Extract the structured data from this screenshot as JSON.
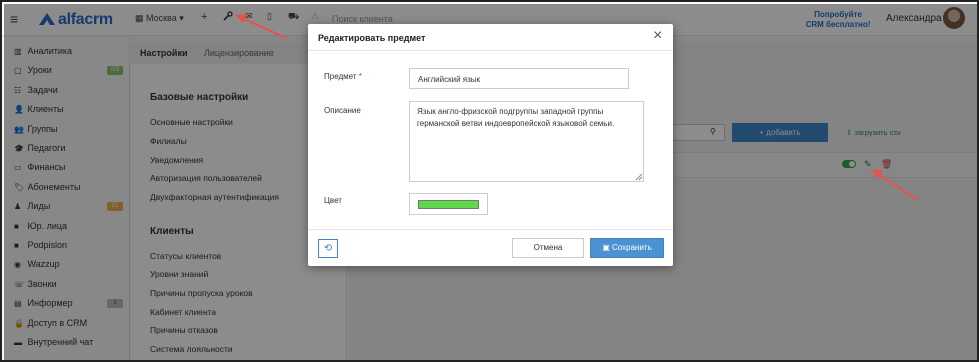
{
  "topbar": {
    "logo_text": "alfacrm",
    "city": "Москва ▾",
    "search_placeholder": "Поиск клиента",
    "try_line1": "Попробуйте",
    "try_line2": "CRM бесплатно!",
    "user_name": "Александра",
    "icons": [
      "menu-icon",
      "building-icon",
      "plus-icon",
      "wrench-icon",
      "envelope-icon",
      "phone-icon",
      "cart-icon",
      "bell-icon"
    ]
  },
  "sidebar": {
    "items": [
      {
        "label": "Аналитика",
        "icon": "chart-icon"
      },
      {
        "label": "Уроки",
        "icon": "calendar-icon",
        "badge": "0/3"
      },
      {
        "label": "Задачи",
        "icon": "tasks-icon"
      },
      {
        "label": "Клиенты",
        "icon": "user-icon"
      },
      {
        "label": "Группы",
        "icon": "users-icon"
      },
      {
        "label": "Педагоги",
        "icon": "graduation-icon"
      },
      {
        "label": "Финансы",
        "icon": "money-icon"
      },
      {
        "label": "Абонементы",
        "icon": "tag-icon"
      },
      {
        "label": "Лиды",
        "icon": "lead-icon",
        "badge": "21"
      },
      {
        "label": "Юр. лица",
        "icon": "briefcase-icon"
      },
      {
        "label": "Podpislon",
        "icon": "briefcase-icon"
      },
      {
        "label": "Wazzup",
        "icon": "whatsapp-icon"
      },
      {
        "label": "Звонки",
        "icon": "phone-icon"
      },
      {
        "label": "Информер",
        "icon": "informer-icon",
        "badge": "3"
      },
      {
        "label": "Доступ в CRM",
        "icon": "lock-icon"
      },
      {
        "label": "Внутренний чат",
        "icon": "chat-icon"
      }
    ]
  },
  "tabs": [
    {
      "label": "Настройки",
      "active": true
    },
    {
      "label": "Лицензирование",
      "active": false
    }
  ],
  "settings": {
    "base_title": "Базовые настройки",
    "base_links": [
      "Основные настройки",
      "Филиалы",
      "Уведомления",
      "Авторизация пользователей",
      "Двухфакторная аутентификация"
    ],
    "clients_title": "Клиенты",
    "clients_links": [
      "Статусы клиентов",
      "Уровни знаний",
      "Причины пропуска уроков",
      "Кабинет клиента",
      "Причины отказов",
      "Система лояльности"
    ]
  },
  "background_list": {
    "add_label": "+ добавить",
    "upload_label": "загрузить csv"
  },
  "modal": {
    "title": "Редактировать предмет",
    "subject_label": "Предмет",
    "required_mark": "*",
    "subject_value": "Английский язык",
    "description_label": "Описание",
    "description_value": "Язык англо-фризской подгруппы западной группы германской ветви индоевропейской языковой семьи.",
    "color_label": "Цвет",
    "color_value": "#5fd84a",
    "cancel_label": "Отмена",
    "save_label": "Сохранить"
  },
  "colors": {
    "brand": "#2a6ac8",
    "primary_button": "#4b92d2",
    "annotation_arrow": "#e8524a"
  }
}
